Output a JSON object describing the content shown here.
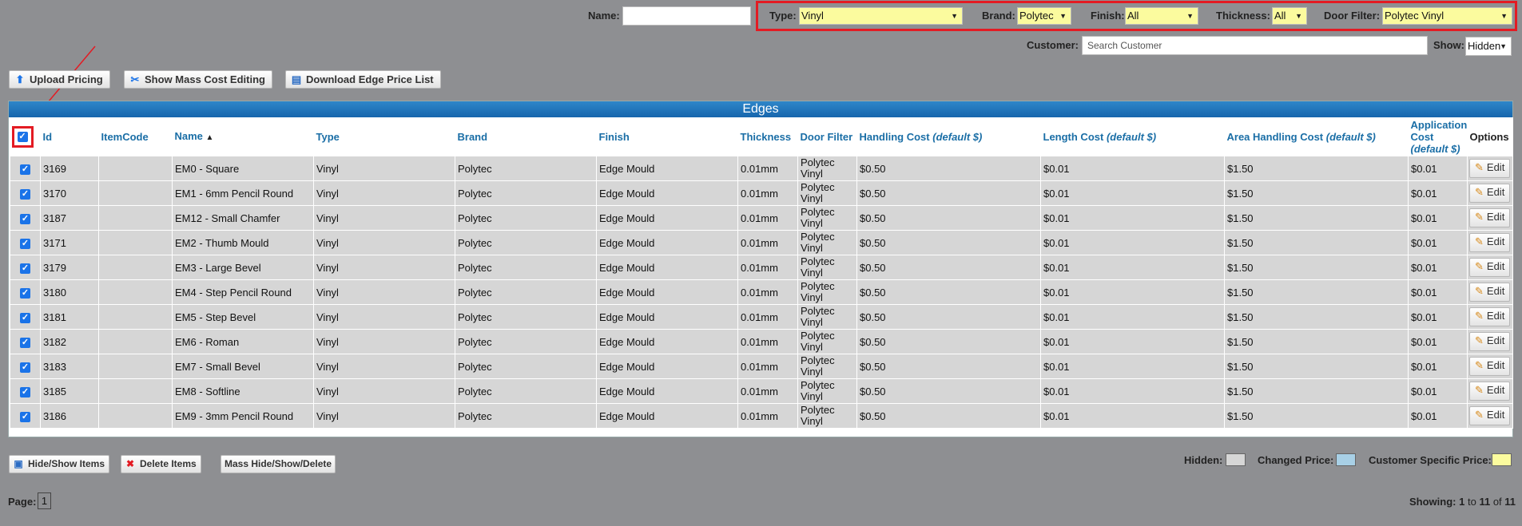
{
  "filters": {
    "name_label": "Name:",
    "name_value": "",
    "type_label": "Type:",
    "type_value": "Vinyl",
    "brand_label": "Brand:",
    "brand_value": "Polytec",
    "finish_label": "Finish:",
    "finish_value": "All",
    "thickness_label": "Thickness:",
    "thickness_value": "All",
    "door_filter_label": "Door Filter:",
    "door_filter_value": "Polytec Vinyl",
    "customer_label": "Customer:",
    "customer_placeholder": "Search Customer",
    "show_label": "Show:",
    "show_value": "Hidden"
  },
  "toolbar": {
    "upload_pricing": "Upload Pricing",
    "show_mass_cost": "Show Mass Cost Editing",
    "download_edge": "Download Edge Price List"
  },
  "table": {
    "title": "Edges",
    "headers": {
      "id": "Id",
      "itemcode": "ItemCode",
      "name": "Name",
      "type": "Type",
      "brand": "Brand",
      "finish": "Finish",
      "thickness": "Thickness",
      "door_filter": "Door Filter",
      "handling_cost": "Handling Cost",
      "length_cost": "Length Cost",
      "area_handling_cost": "Area Handling Cost",
      "application_cost": "Application Cost",
      "default_suffix": "(default $)",
      "options": "Options"
    },
    "edit_label": "Edit",
    "rows": [
      {
        "id": "3169",
        "itemcode": "",
        "name": "EM0 - Square",
        "type": "Vinyl",
        "brand": "Polytec",
        "finish": "Edge Mould",
        "thickness": "0.01mm",
        "door_filter": "Polytec Vinyl",
        "handling": "$0.50",
        "length": "$0.01",
        "area": "$1.50",
        "application": "$0.01"
      },
      {
        "id": "3170",
        "itemcode": "",
        "name": "EM1 - 6mm Pencil Round",
        "type": "Vinyl",
        "brand": "Polytec",
        "finish": "Edge Mould",
        "thickness": "0.01mm",
        "door_filter": "Polytec Vinyl",
        "handling": "$0.50",
        "length": "$0.01",
        "area": "$1.50",
        "application": "$0.01"
      },
      {
        "id": "3187",
        "itemcode": "",
        "name": "EM12 - Small Chamfer",
        "type": "Vinyl",
        "brand": "Polytec",
        "finish": "Edge Mould",
        "thickness": "0.01mm",
        "door_filter": "Polytec Vinyl",
        "handling": "$0.50",
        "length": "$0.01",
        "area": "$1.50",
        "application": "$0.01"
      },
      {
        "id": "3171",
        "itemcode": "",
        "name": "EM2 - Thumb Mould",
        "type": "Vinyl",
        "brand": "Polytec",
        "finish": "Edge Mould",
        "thickness": "0.01mm",
        "door_filter": "Polytec Vinyl",
        "handling": "$0.50",
        "length": "$0.01",
        "area": "$1.50",
        "application": "$0.01"
      },
      {
        "id": "3179",
        "itemcode": "",
        "name": "EM3 - Large Bevel",
        "type": "Vinyl",
        "brand": "Polytec",
        "finish": "Edge Mould",
        "thickness": "0.01mm",
        "door_filter": "Polytec Vinyl",
        "handling": "$0.50",
        "length": "$0.01",
        "area": "$1.50",
        "application": "$0.01"
      },
      {
        "id": "3180",
        "itemcode": "",
        "name": "EM4 - Step Pencil Round",
        "type": "Vinyl",
        "brand": "Polytec",
        "finish": "Edge Mould",
        "thickness": "0.01mm",
        "door_filter": "Polytec Vinyl",
        "handling": "$0.50",
        "length": "$0.01",
        "area": "$1.50",
        "application": "$0.01"
      },
      {
        "id": "3181",
        "itemcode": "",
        "name": "EM5 - Step Bevel",
        "type": "Vinyl",
        "brand": "Polytec",
        "finish": "Edge Mould",
        "thickness": "0.01mm",
        "door_filter": "Polytec Vinyl",
        "handling": "$0.50",
        "length": "$0.01",
        "area": "$1.50",
        "application": "$0.01"
      },
      {
        "id": "3182",
        "itemcode": "",
        "name": "EM6 - Roman",
        "type": "Vinyl",
        "brand": "Polytec",
        "finish": "Edge Mould",
        "thickness": "0.01mm",
        "door_filter": "Polytec Vinyl",
        "handling": "$0.50",
        "length": "$0.01",
        "area": "$1.50",
        "application": "$0.01"
      },
      {
        "id": "3183",
        "itemcode": "",
        "name": "EM7 - Small Bevel",
        "type": "Vinyl",
        "brand": "Polytec",
        "finish": "Edge Mould",
        "thickness": "0.01mm",
        "door_filter": "Polytec Vinyl",
        "handling": "$0.50",
        "length": "$0.01",
        "area": "$1.50",
        "application": "$0.01"
      },
      {
        "id": "3185",
        "itemcode": "",
        "name": "EM8 - Softline",
        "type": "Vinyl",
        "brand": "Polytec",
        "finish": "Edge Mould",
        "thickness": "0.01mm",
        "door_filter": "Polytec Vinyl",
        "handling": "$0.50",
        "length": "$0.01",
        "area": "$1.50",
        "application": "$0.01"
      },
      {
        "id": "3186",
        "itemcode": "",
        "name": "EM9 - 3mm Pencil Round",
        "type": "Vinyl",
        "brand": "Polytec",
        "finish": "Edge Mould",
        "thickness": "0.01mm",
        "door_filter": "Polytec Vinyl",
        "handling": "$0.50",
        "length": "$0.01",
        "area": "$1.50",
        "application": "$0.01"
      }
    ]
  },
  "bottom": {
    "hide_show": "Hide/Show Items",
    "delete": "Delete Items",
    "mass": "Mass Hide/Show/Delete",
    "legend_hidden": "Hidden:",
    "legend_changed": "Changed Price:",
    "legend_customer": "Customer Specific Price:",
    "page_label": "Page:",
    "page_number": "1",
    "showing_prefix": "Showing:",
    "showing_from": "1",
    "showing_to_word": "to",
    "showing_to": "11",
    "showing_of_word": "of",
    "showing_total": "11"
  },
  "colors": {
    "background": "#8e8f92",
    "highlight_red": "#e31b23",
    "header_blue": "#1766ad",
    "legend_hidden": "#d6d6d6",
    "legend_changed": "#a8d0e6",
    "legend_customer": "#fbfb9e"
  }
}
